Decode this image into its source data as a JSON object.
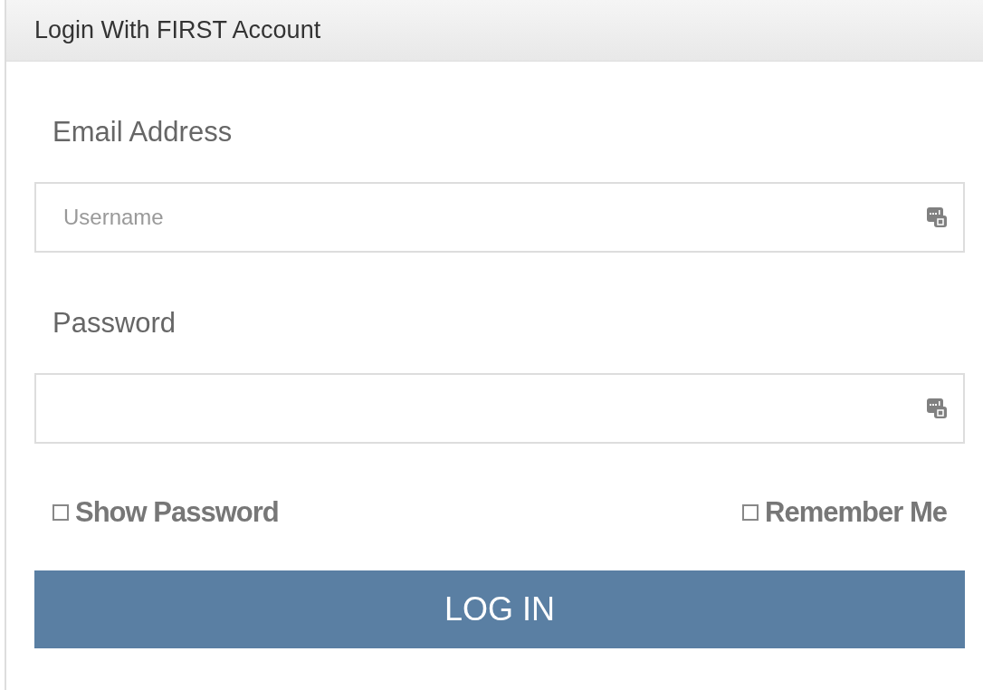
{
  "panel": {
    "title": "Login With FIRST Account"
  },
  "fields": [
    {
      "label": "Email Address",
      "placeholder": "Username"
    },
    {
      "label": "Password"
    }
  ],
  "options": [
    {
      "label": "Show Password",
      "checked": false
    },
    {
      "label": "Remember Me",
      "checked": false
    }
  ],
  "button": "LOG IN"
}
